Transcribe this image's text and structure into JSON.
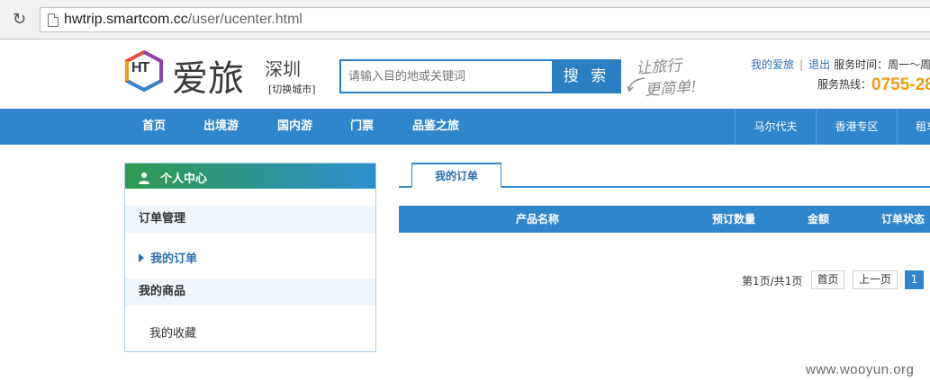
{
  "browser": {
    "url_host": "hwtrip.smartcom.cc",
    "url_path": "/user/ucenter.html"
  },
  "header": {
    "logo_text": "HT",
    "brand": "爱旅",
    "city": "深圳",
    "switch_city": "[切换城市]",
    "search_placeholder": "请输入目的地或关键词",
    "search_button": "搜 索",
    "slogan_line1": "让旅行",
    "slogan_line2": "更简单!",
    "my_aily": "我的爱旅",
    "separator": "|",
    "logout": "退出",
    "service_time": "服务时间：周一～周",
    "hotline_label": "服务热线：",
    "hotline_number": "0755-28"
  },
  "nav": {
    "items": [
      "首页",
      "出境游",
      "国内游",
      "门票",
      "品鉴之旅"
    ],
    "right_items": [
      "马尔代夫",
      "香港专区",
      "租车"
    ]
  },
  "sidebar": {
    "title": "个人中心",
    "group_orders": "订单管理",
    "my_orders": "我的订单",
    "group_products": "我的商品",
    "favorites": "我的收藏"
  },
  "main": {
    "tab": "我的订单",
    "columns": [
      "产品名称",
      "预订数量",
      "金额",
      "订单状态"
    ],
    "pager": {
      "info": "第1页/共1页",
      "first": "首页",
      "prev": "上一页",
      "current": "1"
    }
  },
  "watermark": "www.wooyun.org",
  "colors": {
    "nav_blue": "#2f86cd",
    "hotline_orange": "#f29a1a",
    "link_blue": "#2b6fb5"
  }
}
